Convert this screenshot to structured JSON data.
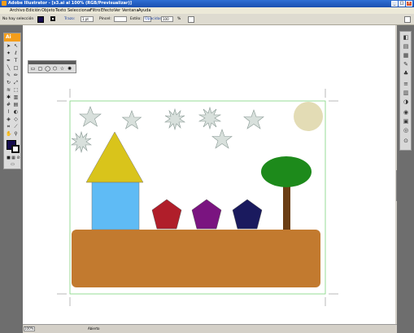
{
  "window": {
    "title": "Adobe Illustrator - [s3.ai al 100% (RGB/Previsualizar)]"
  },
  "menu": [
    "Archivo",
    "Edición",
    "Objeto",
    "Texto",
    "Seleccionar",
    "Filtro",
    "Efecto",
    "Ver",
    "Ventana",
    "Ayuda"
  ],
  "control": {
    "selection": "No hay selección",
    "stroke_label": "Trazo:",
    "stroke_value": "1 pt",
    "brush_label": "Pincel:",
    "style_label": "Estilo:",
    "opacity_label": "Opacidad:",
    "opacity_value": "100",
    "opacity_unit": "%"
  },
  "toolbox": {
    "header": "Ai"
  },
  "status": {
    "zoom": "100%",
    "state": "Abierto"
  },
  "colors": {
    "fill_swatch": "#150a4e",
    "sky_sun": "#e3dcb5",
    "star": "#d8e0dc",
    "roof": "#d9c41b",
    "wall": "#5fbbf5",
    "pentagon_red": "#b01e2a",
    "pentagon_purple": "#7a1480",
    "pentagon_navy": "#1a1a5e",
    "tree_top": "#1d8a1b",
    "trunk": "#6b3e14",
    "ground": "#c27a2f"
  }
}
